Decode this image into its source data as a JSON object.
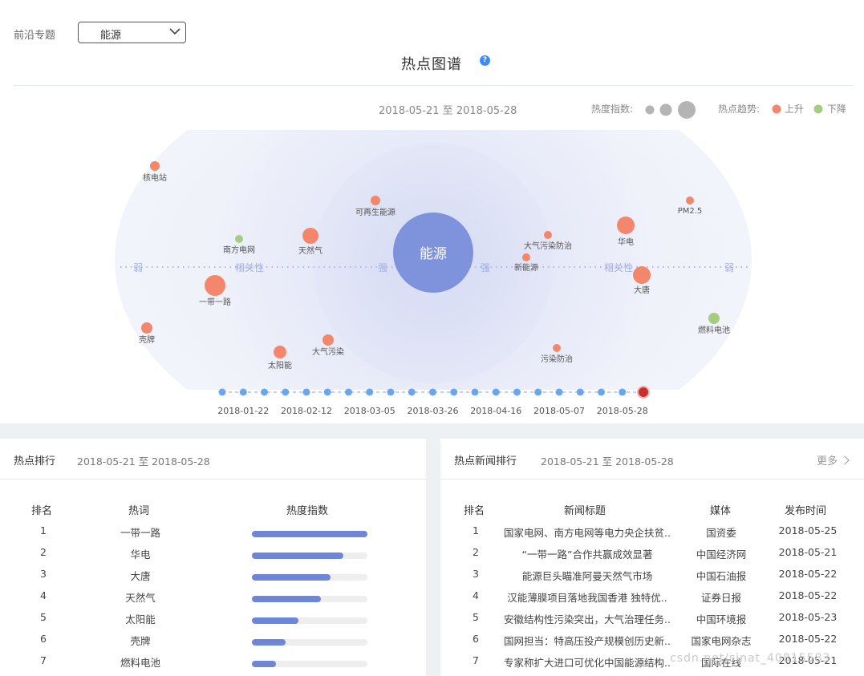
{
  "filter": {
    "label": "前沿专题",
    "selected": "能源"
  },
  "title": "热点图谱",
  "help_glyph": "?",
  "date_range": "2018-05-21 至 2018-05-28",
  "legend": {
    "heat_label": "热度指数:",
    "trend_label": "热点趋势:",
    "up": "上升",
    "down": "下降",
    "up_color": "#f4876b",
    "down_color": "#a6cd7f",
    "heat_color": "#b4b4b4"
  },
  "graph": {
    "center": "能源",
    "axis_labels": {
      "weak": "弱",
      "strong": "强",
      "relevance": "相关性"
    },
    "nodes": [
      {
        "label": "核电站",
        "trend": "up"
      },
      {
        "label": "可再生能源",
        "trend": "up"
      },
      {
        "label": "PM2.5",
        "trend": "up"
      },
      {
        "label": "南方电网",
        "trend": "down"
      },
      {
        "label": "天然气",
        "trend": "up"
      },
      {
        "label": "大气污染防治",
        "trend": "up"
      },
      {
        "label": "华电",
        "trend": "up"
      },
      {
        "label": "新能源",
        "trend": "up"
      },
      {
        "label": "一带一路",
        "trend": "up"
      },
      {
        "label": "大唐",
        "trend": "up"
      },
      {
        "label": "壳牌",
        "trend": "up"
      },
      {
        "label": "燃料电池",
        "trend": "down"
      },
      {
        "label": "太阳能",
        "trend": "up"
      },
      {
        "label": "大气污染",
        "trend": "up"
      },
      {
        "label": "污染防治",
        "trend": "up"
      }
    ]
  },
  "timeline": {
    "labels": [
      "2018-01-22",
      "2018-02-12",
      "2018-03-05",
      "2018-03-26",
      "2018-04-16",
      "2018-05-07",
      "2018-05-28"
    ],
    "point_count": 21,
    "selected": "2018-05-28"
  },
  "hot_rank": {
    "title": "热点排行",
    "date_range": "2018-05-21 至 2018-05-28",
    "headers": [
      "排名",
      "热词",
      "热度指数"
    ],
    "rows": [
      {
        "rank": "1",
        "word": "一带一路",
        "heat": 1.0
      },
      {
        "rank": "2",
        "word": "华电",
        "heat": 0.79
      },
      {
        "rank": "3",
        "word": "大唐",
        "heat": 0.68
      },
      {
        "rank": "4",
        "word": "天然气",
        "heat": 0.6
      },
      {
        "rank": "5",
        "word": "太阳能",
        "heat": 0.4
      },
      {
        "rank": "6",
        "word": "壳牌",
        "heat": 0.29
      },
      {
        "rank": "7",
        "word": "燃料电池",
        "heat": 0.21
      }
    ]
  },
  "news_rank": {
    "title": "热点新闻排行",
    "date_range": "2018-05-21 至 2018-05-28",
    "more": "更多",
    "headers": [
      "排名",
      "新闻标题",
      "媒体",
      "发布时间"
    ],
    "rows": [
      {
        "rank": "1",
        "title": "国家电网、南方电网等电力央企扶贫..",
        "media": "国资委",
        "date": "2018-05-25"
      },
      {
        "rank": "2",
        "title": "“一带一路”合作共赢成效显著",
        "media": "中国经济网",
        "date": "2018-05-21"
      },
      {
        "rank": "3",
        "title": "能源巨头瞄准阿曼天然气市场",
        "media": "中国石油报",
        "date": "2018-05-22"
      },
      {
        "rank": "4",
        "title": "汉能薄膜项目落地我国香港 独特优..",
        "media": "证券日报",
        "date": "2018-05-22"
      },
      {
        "rank": "5",
        "title": "安徽结构性污染突出，大气治理任务..",
        "media": "中国环境报",
        "date": "2018-05-23"
      },
      {
        "rank": "6",
        "title": "国网担当：特高压投产规模创历史新..",
        "media": "国家电网杂志",
        "date": "2018-05-22"
      },
      {
        "rank": "7",
        "title": "专家称扩大进口可优化中国能源结构..",
        "media": "国际在线",
        "date": "2018-05-21"
      }
    ]
  },
  "watermark": "csdn.net/sinat_40815583"
}
